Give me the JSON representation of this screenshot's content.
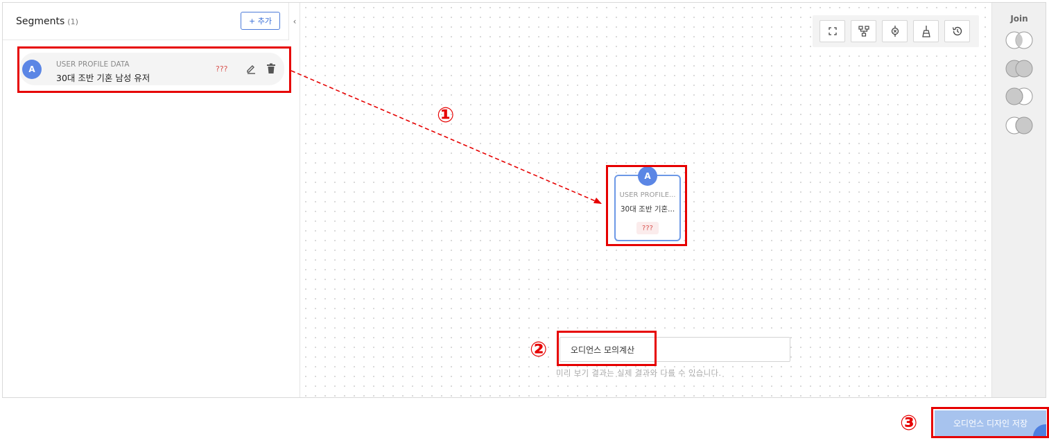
{
  "left_panel": {
    "title": "Segments",
    "count": "(1)",
    "add_label": "+ 추가",
    "collapse_glyph": "‹",
    "segment": {
      "avatar": "A",
      "type": "USER PROFILE DATA",
      "name": "30대 조반 기혼 남성 유저",
      "badge": "???"
    }
  },
  "canvas": {
    "toolbar_icons": [
      "fit-screen-icon",
      "tree-layout-icon",
      "center-icon",
      "clean-icon",
      "history-icon"
    ],
    "node": {
      "avatar": "A",
      "type": "USER PROFILE...",
      "name": "30대 조반 기혼...",
      "badge": "???"
    },
    "calc_label": "오디언스 모의계산",
    "preview_note": "미리 보기 결과는 실제 결과와 다를 수 있습니다."
  },
  "join_panel": {
    "title": "Join",
    "options": [
      "left-exclude-join-icon",
      "intersection-join-icon",
      "left-join-icon",
      "right-join-icon"
    ]
  },
  "save_label": "오디언스 디자인 저장",
  "annotations": {
    "step1": "①",
    "step2": "②",
    "step3": "③",
    "color": "#e60000"
  },
  "colors": {
    "accent": "#5b86e5",
    "badge_red": "#d9534f",
    "save_button": "#a7c3ee"
  }
}
